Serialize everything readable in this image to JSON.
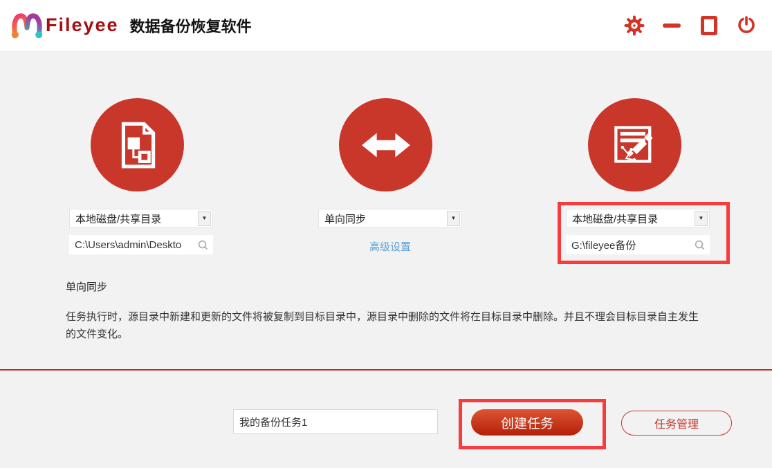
{
  "header": {
    "brand": "Fileyee",
    "title": "数据备份恢复软件",
    "window_icons": [
      "settings-gear",
      "minimize",
      "maximize",
      "power"
    ]
  },
  "source": {
    "type_option": "本地磁盘/共享目录",
    "path": "C:\\Users\\admin\\Deskto",
    "circle_icon": "file-diagram"
  },
  "sync": {
    "mode_option": "单向同步",
    "advanced_link": "高级设置",
    "circle_icon": "double-arrow"
  },
  "target": {
    "type_option": "本地磁盘/共享目录",
    "path": "G:\\fileyee备份",
    "circle_icon": "edit-document"
  },
  "description": {
    "heading": "单向同步",
    "body": "任务执行时，源目录中新建和更新的文件将被复制到目标目录中，源目录中删除的文件将在目标目录中删除。并且不理会目标目录自主发生的文件变化。"
  },
  "footer": {
    "task_name_value": "我的备份任务1",
    "create_label": "创建任务",
    "manage_label": "任务管理"
  },
  "colors": {
    "accent_red": "#c9362a",
    "header_icon_red": "#d33426",
    "annotation_red": "#f83b3d",
    "brand_red": "#a60e13",
    "link_blue": "#56a1d2",
    "divider_red": "#bd3124",
    "background": "#f2f2f2"
  }
}
